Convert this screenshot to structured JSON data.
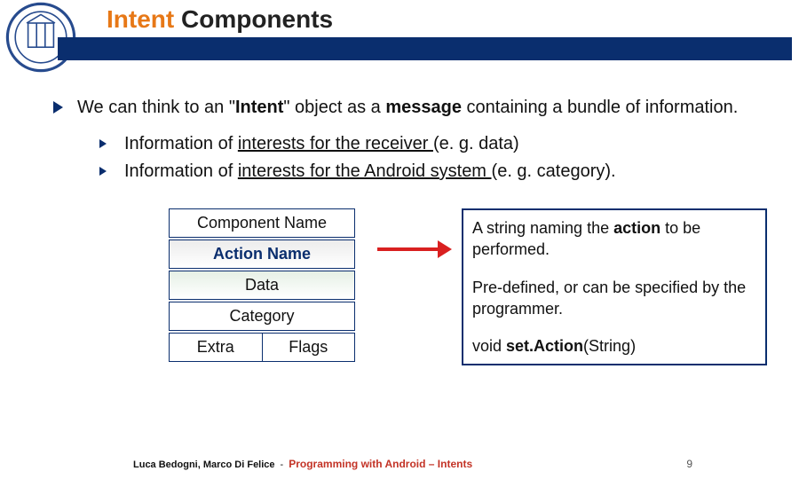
{
  "header": {
    "title_strong": "Intent",
    "title_rest": " Components"
  },
  "main": {
    "intro_pre": "We can think to an \"",
    "intro_bold1": "Intent",
    "intro_mid": "\" object as a ",
    "intro_bold2": "message",
    "intro_post": " containing a bundle of information.",
    "sub1_pre": "Information of ",
    "sub1_u": "interests for the receiver ",
    "sub1_post": "(e. g. data)",
    "sub2_pre": "Information of ",
    "sub2_u": "interests for the Android system ",
    "sub2_post": "(e. g. category)."
  },
  "boxes": {
    "b1": "Component Name",
    "b2": "Action Name",
    "b3": "Data",
    "b4": "Category",
    "b5a": "Extra",
    "b5b": "Flags"
  },
  "desc": {
    "p1_pre": "A string naming the ",
    "p1_b": "action",
    "p1_post": " to be performed.",
    "p2": "Pre-defined, or can be specified by the programmer.",
    "p3_pre": "void ",
    "p3_b": "set.Action",
    "p3_post": "(String)"
  },
  "footer": {
    "authors": "Luca Bedogni, Marco Di Felice",
    "course": "Programming with Android – Intents",
    "page": "9"
  }
}
